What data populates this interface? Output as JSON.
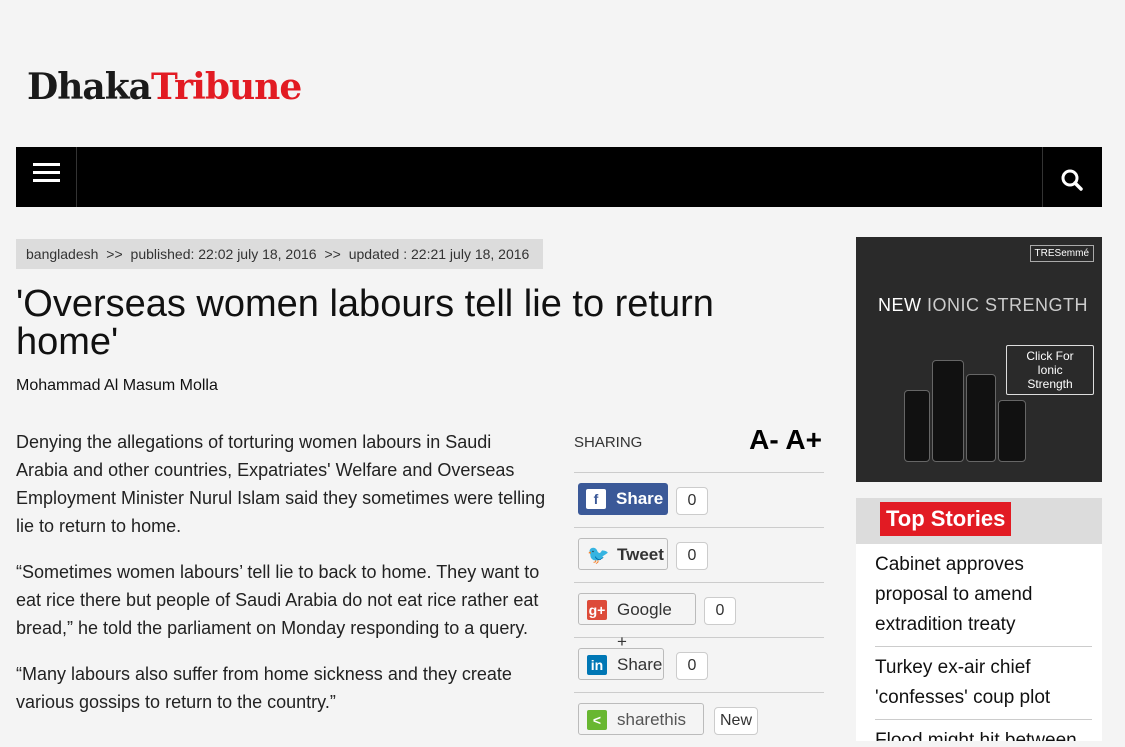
{
  "logo": {
    "part1": "Dhaka",
    "part2": "Tribune"
  },
  "breadcrumb": {
    "section": "bangladesh",
    "sep1": ">>",
    "published": "published: 22:02 july 18, 2016",
    "sep2": ">>",
    "updated": "updated : 22:21 july 18, 2016"
  },
  "article": {
    "title": "'Overseas women labours tell lie to return home'",
    "author": "Mohammad Al Masum Molla",
    "paragraphs": [
      "Denying the allegations of torturing women labours in Saudi Arabia and other countries, Expatriates' Welfare and Overseas Employment Minister Nurul Islam said they sometimes were telling lie to return to home.",
      "“Sometimes women labours’ tell lie to back to home. They want to eat rice there but people of Saudi Arabia do not eat rice rather eat bread,” he told the parliament on Monday responding to a query.",
      "“Many labours also suffer from home sickness and they create various gossips to return to the country.”"
    ]
  },
  "sharing": {
    "label": "SHARING",
    "font_size": "A- A+",
    "buttons": [
      {
        "label": "Share",
        "icon": "f",
        "count": "0"
      },
      {
        "label": "Tweet",
        "icon": "🐦",
        "count": "0"
      },
      {
        "label": "Google +",
        "icon": "g+",
        "count": "0"
      },
      {
        "label": "Share",
        "icon": "in",
        "count": "0"
      },
      {
        "label": "sharethis",
        "icon": "<",
        "count": "New"
      }
    ]
  },
  "ad": {
    "brand": "TRESemmé",
    "headline_bold": "NEW",
    "headline_thin": "IONIC STRENGTH",
    "cta": "Click For Ionic Strength"
  },
  "top_stories": {
    "header": "Top Stories",
    "items": [
      "Cabinet approves proposal to amend extradition treaty",
      "Turkey ex-air chief 'confesses' coup plot",
      "Flood might hit between"
    ]
  },
  "colors": {
    "brand_red": "#e21b23",
    "nav_black": "#000000",
    "facebook": "#3b5998"
  }
}
